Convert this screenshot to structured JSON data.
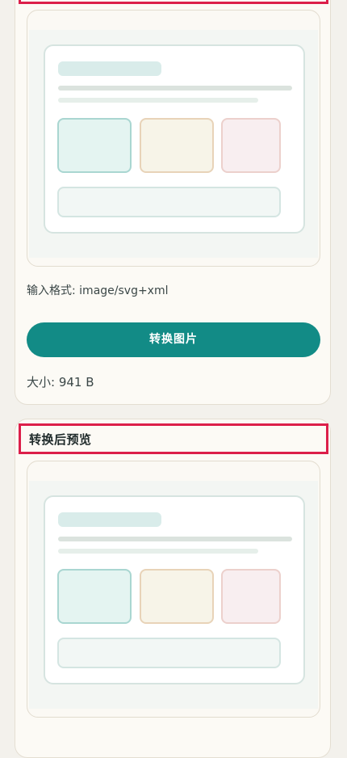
{
  "input_panel": {
    "format_label": "输入格式: image/svg+xml",
    "convert_button_label": "转换图片",
    "size_label": "大小: 941 B"
  },
  "output_panel": {
    "title": "转换后预览"
  },
  "colors": {
    "accent": "#128b86",
    "highlight": "#dc1f4a",
    "card_bg": "#fcfaf5",
    "page_bg": "#f3f1ec"
  }
}
